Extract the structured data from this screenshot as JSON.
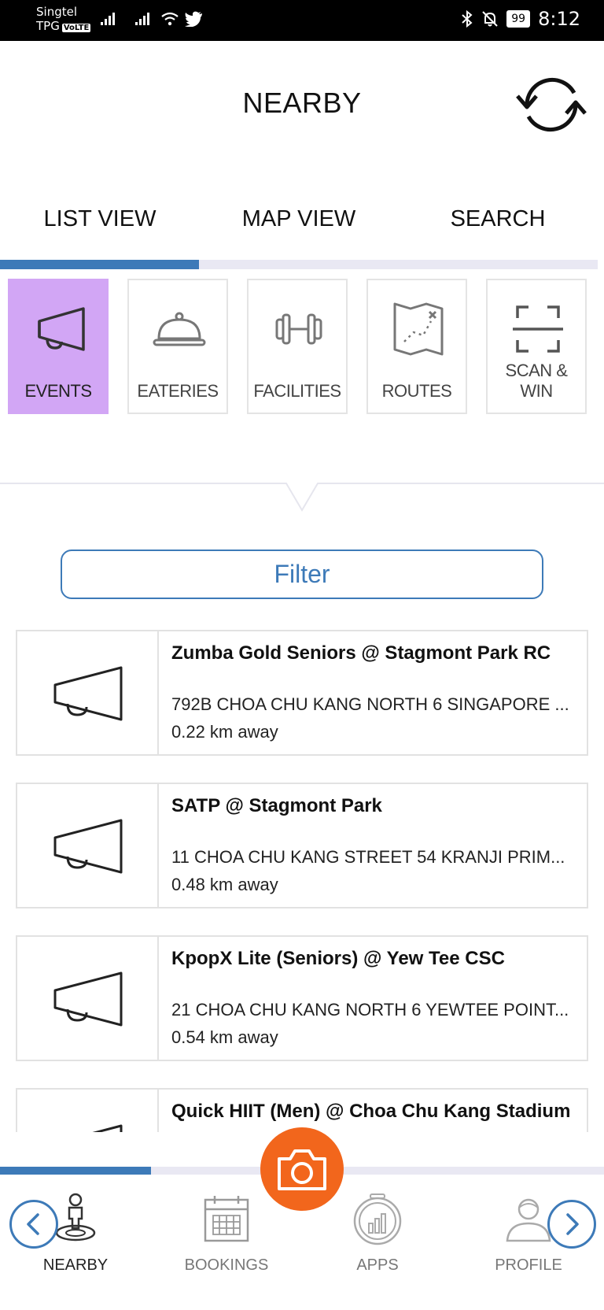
{
  "status_bar": {
    "carrier_line1": "Singtel",
    "carrier_line2": "TPG",
    "volte": "VoLTE",
    "battery": "99",
    "time": "8:12"
  },
  "header": {
    "title": "NEARBY",
    "refresh_icon": "refresh-icon"
  },
  "view_tabs": {
    "list": "LIST VIEW",
    "map": "MAP VIEW",
    "search": "SEARCH",
    "active": "LIST VIEW"
  },
  "categories": [
    {
      "label": "EVENTS",
      "icon": "megaphone-icon",
      "active": true
    },
    {
      "label": "EATERIES",
      "icon": "food-cloche-icon",
      "active": false
    },
    {
      "label": "FACILITIES",
      "icon": "dumbbell-icon",
      "active": false
    },
    {
      "label": "ROUTES",
      "icon": "map-route-icon",
      "active": false
    },
    {
      "label": "SCAN & WIN",
      "icon": "scan-frame-icon",
      "active": false
    }
  ],
  "filter": {
    "label": "Filter"
  },
  "events": [
    {
      "title": "Zumba Gold Seniors @ Stagmont Park RC",
      "address": "792B CHOA CHU KANG NORTH 6 SINGAPORE ...",
      "distance": "0.22 km away"
    },
    {
      "title": "SATP @ Stagmont Park",
      "address": "11 CHOA CHU KANG STREET 54 KRANJI PRIM...",
      "distance": "0.48 km away"
    },
    {
      "title": "KpopX Lite (Seniors) @ Yew Tee CSC",
      "address": "21 CHOA CHU KANG NORTH 6 YEWTEE POINT...",
      "distance": "0.54 km away"
    },
    {
      "title": "Quick HIIT (Men) @ Choa Chu Kang Stadium",
      "address": "",
      "distance": ""
    }
  ],
  "bottom_nav": {
    "items": [
      {
        "label": "NEARBY",
        "icon": "location-person-icon",
        "active": true
      },
      {
        "label": "BOOKINGS",
        "icon": "calendar-icon",
        "active": false
      },
      {
        "label": "APPS",
        "icon": "apps-chart-icon",
        "active": false
      },
      {
        "label": "PROFILE",
        "icon": "profile-person-icon",
        "active": false
      }
    ],
    "camera_icon": "camera-icon"
  },
  "colors": {
    "accent_blue": "#3d7ab8",
    "active_category": "#d2a6f5",
    "camera_orange": "#f2661c"
  }
}
